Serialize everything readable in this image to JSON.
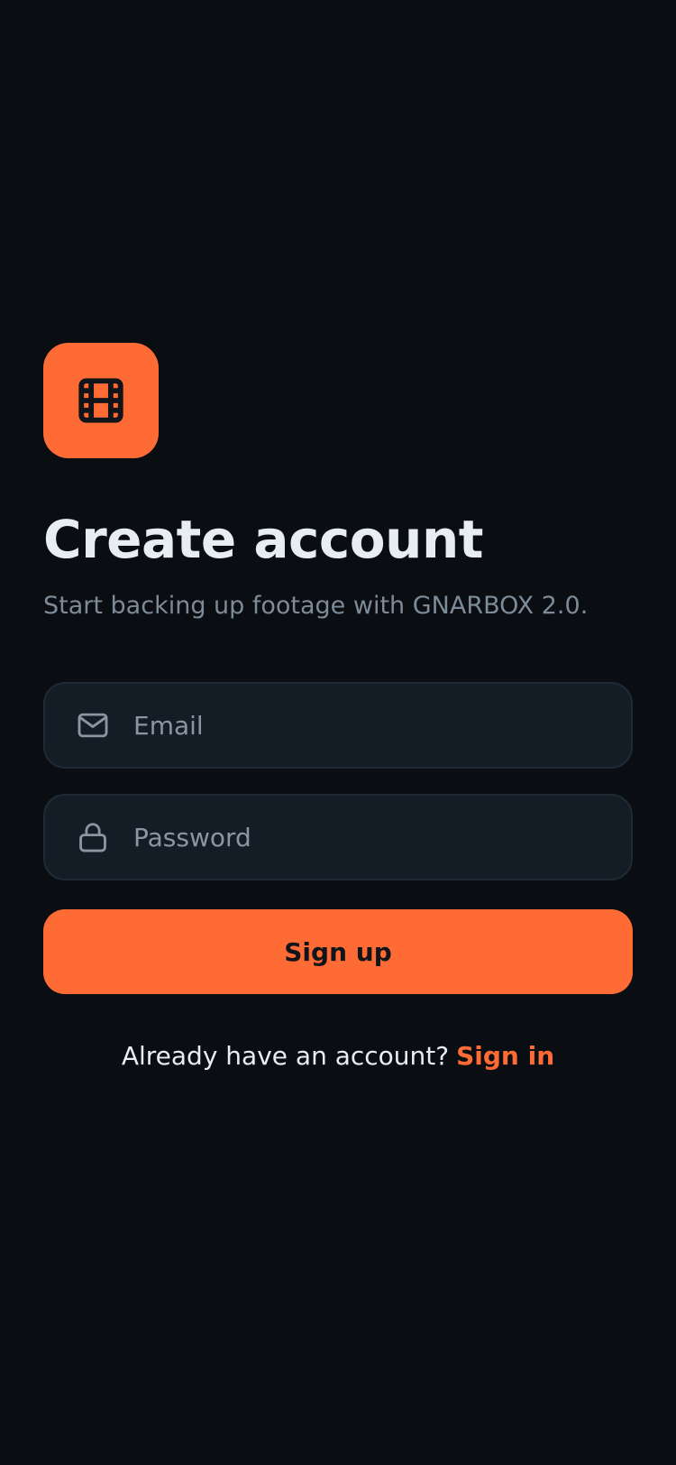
{
  "brand": {
    "accent": "#ff6b35",
    "background": "#0a0e13",
    "logo_icon": "film-icon"
  },
  "header": {
    "title": "Create account",
    "subtitle": "Start backing up footage with GNARBOX 2.0."
  },
  "form": {
    "email": {
      "icon": "mail-icon",
      "placeholder": "Email",
      "value": ""
    },
    "password": {
      "icon": "lock-icon",
      "placeholder": "Password",
      "value": ""
    },
    "submit_label": "Sign up"
  },
  "footer": {
    "prompt": "Already have an account?",
    "link_label": "Sign in"
  }
}
